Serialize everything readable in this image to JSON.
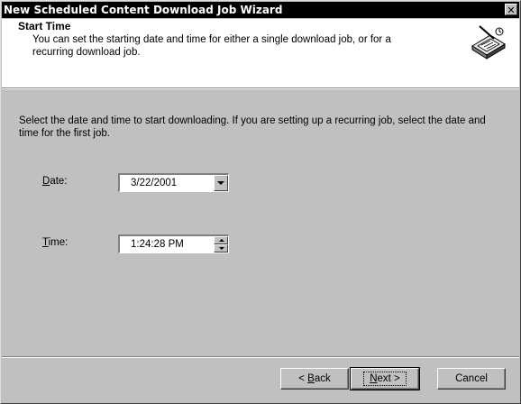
{
  "window": {
    "title": "New Scheduled Content Download Job Wizard",
    "close_glyph": "✕"
  },
  "header": {
    "title": "Start Time",
    "subtitle": "You can set the starting date and time for either a single download job, or for a recurring download job.",
    "icon": "wizard-scheduler-icon"
  },
  "body": {
    "instructions": "Select the date and time to start downloading. If you are setting up a recurring job, select the date and time for the first job.",
    "date_label_mnemonic": "D",
    "date_label_rest": "ate:",
    "date_value": "3/22/2001",
    "time_label_mnemonic": "T",
    "time_label_rest": "ime:",
    "time_value": "1:24:28 PM"
  },
  "buttons": {
    "back_prefix": "< ",
    "back_mnemonic": "B",
    "back_rest": "ack",
    "next_mnemonic": "N",
    "next_rest": "ext >",
    "cancel": "Cancel"
  }
}
